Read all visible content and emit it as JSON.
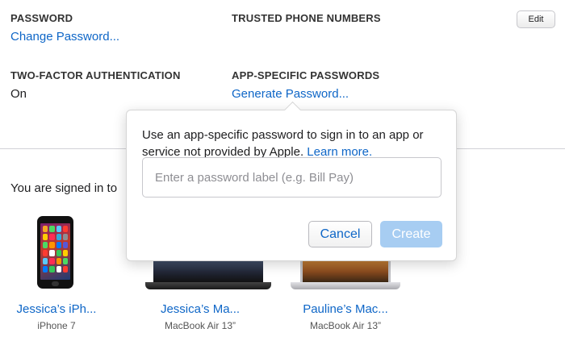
{
  "security": {
    "password_heading": "PASSWORD",
    "change_password_link": "Change Password...",
    "trusted_heading": "TRUSTED PHONE NUMBERS",
    "edit_label": "Edit",
    "two_factor_heading": "TWO-FACTOR AUTHENTICATION",
    "two_factor_value": "On",
    "app_passwords_heading": "APP-SPECIFIC PASSWORDS",
    "generate_password_link": "Generate Password..."
  },
  "devices": {
    "signed_in_text": "You are signed in to",
    "items": [
      {
        "name": "Jessica’s iPh...",
        "model": "iPhone 7"
      },
      {
        "name": "Jessica’s Ma...",
        "model": "MacBook Air 13”"
      },
      {
        "name": "Pauline’s Mac...",
        "model": "MacBook Air 13”"
      }
    ]
  },
  "popover": {
    "description": "Use an app-specific password to sign in to an app or service not provided by Apple.",
    "learn_more": "Learn more.",
    "input_placeholder": "Enter a password label (e.g. Bill Pay)",
    "input_value": "",
    "cancel_label": "Cancel",
    "create_label": "Create"
  },
  "colors": {
    "link": "#0e66c7",
    "create_disabled": "#a7cdf2"
  }
}
